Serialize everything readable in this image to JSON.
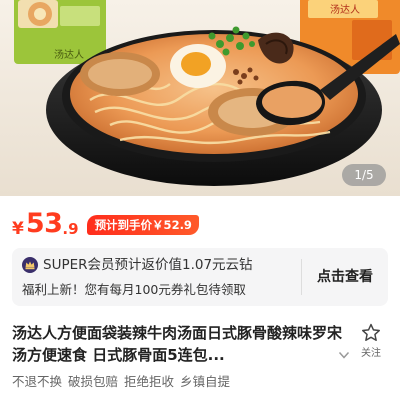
{
  "gallery": {
    "page_indicator": "1/5",
    "package_text_left": "汤达人",
    "package_text_right": "汤达人",
    "image_subject": "bowl of tonkotsu ramen with egg, pork slices, green onion and a spoon"
  },
  "price": {
    "currency": "¥",
    "integer": "53",
    "decimal": ".9",
    "badge": "预计到手价￥52.9",
    "accent_color": "#ff3c1f"
  },
  "super": {
    "icon": "crown-icon",
    "line1": "SUPER会员预计返价值1.07元云钻",
    "line2": "福利上新！您有每月100元券礼包待领取",
    "button": "点击查看"
  },
  "product": {
    "title": "汤达人方便面袋装辣牛肉汤面日式豚骨酸辣味罗宋汤方便速食 日式豚骨面5连包...",
    "favorite_label": "关注"
  },
  "tags": [
    "不退不换",
    "破损包赔",
    "拒绝拒收",
    "乡镇自提"
  ]
}
